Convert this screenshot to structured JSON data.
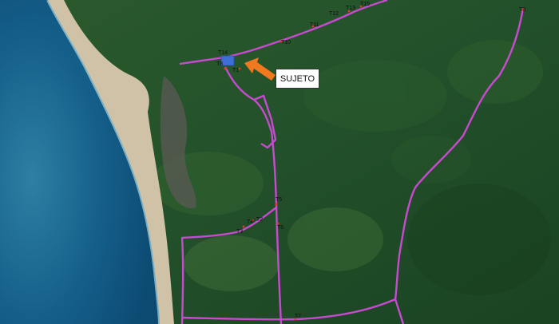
{
  "callout": {
    "text": "SUJETO"
  },
  "markers": [
    "T1",
    "T2",
    "T3",
    "T4",
    "T5",
    "T6",
    "T7",
    "T8",
    "T9",
    "T10",
    "T11",
    "T12",
    "T13",
    "T14",
    "T15"
  ],
  "colors": {
    "ocean_deep": "#0f4f78",
    "ocean_shallow": "#3f8fae",
    "sand": "#cfc2a6",
    "forest": "#1f4a25",
    "route": "#c84ad0",
    "subject_marker": "#3f6fd4",
    "arrow": "#f0781e"
  },
  "icons": [
    "subject-rectangle-marker",
    "pointer-arrow"
  ]
}
